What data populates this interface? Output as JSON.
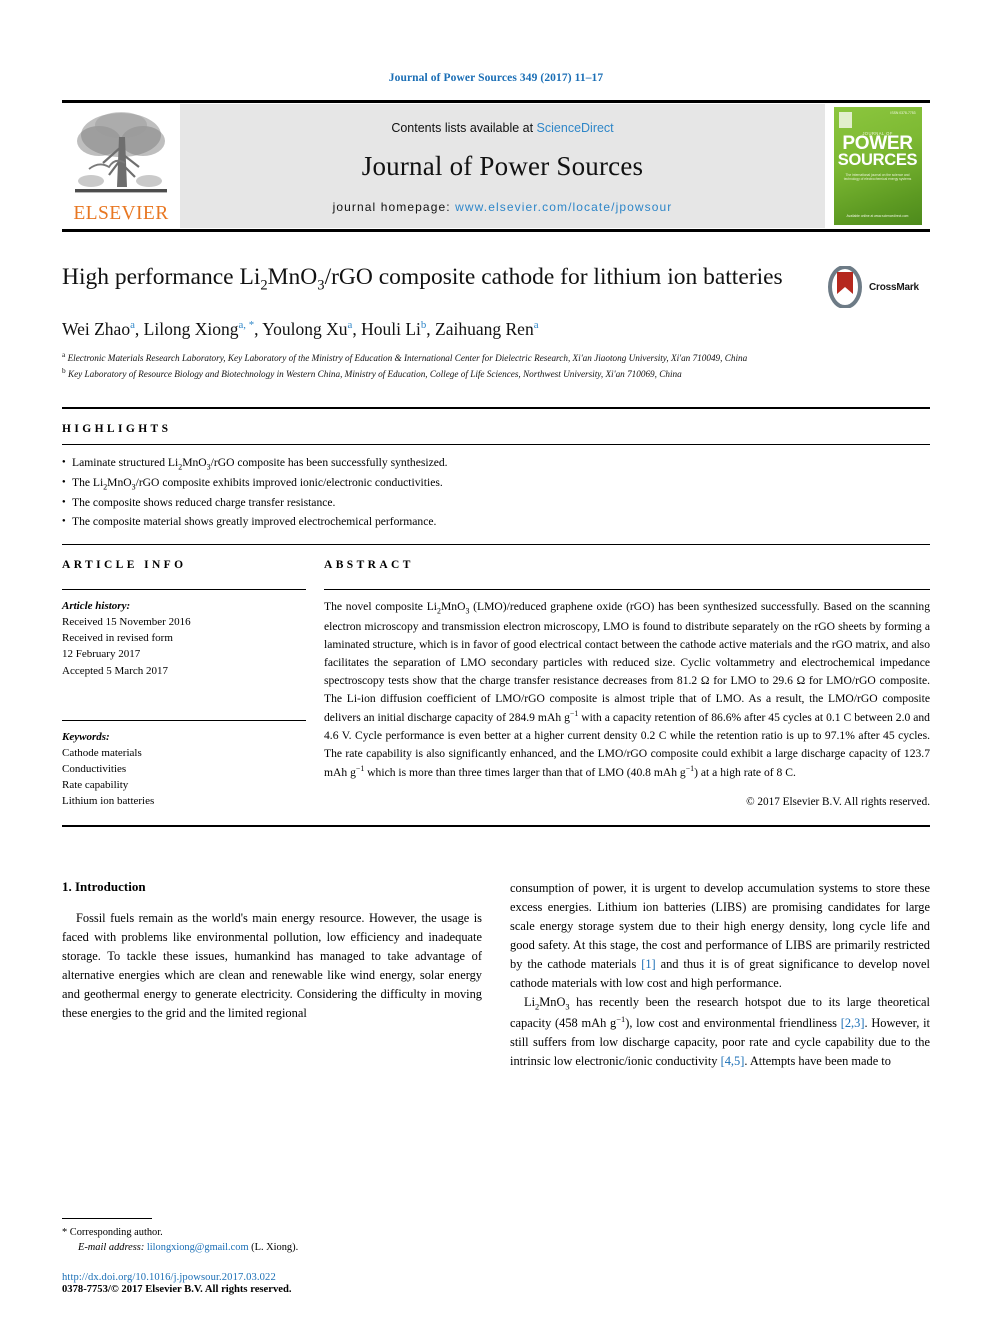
{
  "running_head": "Journal of Power Sources 349 (2017) 11–17",
  "masthead": {
    "publisher_name": "ELSEVIER",
    "publisher_logo": "elsevier-tree-logo",
    "contents_prefix": "Contents lists available at ",
    "contents_link": "ScienceDirect",
    "journal_title": "Journal of Power Sources",
    "homepage_prefix": "journal homepage: ",
    "homepage_url": "www.elsevier.com/locate/jpowsour",
    "cover": {
      "top_label": "ISSN 0378-7753",
      "eyebrow": "JOURNAL OF",
      "line1": "POWER",
      "line2": "SOURCES",
      "subtitle": "The international journal on the science and technology of electrochemical energy systems",
      "footer": "Available online at\nwww.sciencedirect.com",
      "accent": "#7db933"
    }
  },
  "article": {
    "title_part1": "High performance Li",
    "title_sub1": "2",
    "title_part2": "MnO",
    "title_sub2": "3",
    "title_part3": "/rGO composite cathode for lithium ion batteries",
    "title_plain": "High performance Li2MnO3/rGO composite cathode for lithium ion batteries",
    "crossmark_label": "CrossMark",
    "authors": [
      {
        "name": "Wei Zhao",
        "marks": "a"
      },
      {
        "name": "Lilong Xiong",
        "marks": "a, *"
      },
      {
        "name": "Youlong Xu",
        "marks": "a"
      },
      {
        "name": "Houli Li",
        "marks": "b"
      },
      {
        "name": "Zaihuang Ren",
        "marks": "a"
      }
    ],
    "affiliations": [
      {
        "mark": "a",
        "text": "Electronic Materials Research Laboratory, Key Laboratory of the Ministry of Education & International Center for Dielectric Research, Xi'an Jiaotong University, Xi'an 710049, China"
      },
      {
        "mark": "b",
        "text": "Key Laboratory of Resource Biology and Biotechnology in Western China, Ministry of Education, College of Life Sciences, Northwest University, Xi'an 710069, China"
      }
    ]
  },
  "highlights": {
    "label": "HIGHLIGHTS",
    "items": [
      "Laminate structured Li2MnO3/rGO composite has been successfully synthesized.",
      "The Li2MnO3/rGO composite exhibits improved ionic/electronic conductivities.",
      "The composite shows reduced charge transfer resistance.",
      "The composite material shows greatly improved electrochemical performance."
    ]
  },
  "article_info": {
    "label": "ARTICLE INFO",
    "history_label": "Article history:",
    "history": [
      "Received 15 November 2016",
      "Received in revised form",
      "12 February 2017",
      "Accepted 5 March 2017"
    ],
    "keywords_label": "Keywords:",
    "keywords": [
      "Cathode materials",
      "Conductivities",
      "Rate capability",
      "Lithium ion batteries"
    ]
  },
  "abstract": {
    "label": "ABSTRACT",
    "text": "The novel composite Li2MnO3 (LMO)/reduced graphene oxide (rGO) has been synthesized successfully. Based on the scanning electron microscopy and transmission electron microscopy, LMO is found to distribute separately on the rGO sheets by forming a laminated structure, which is in favor of good electrical contact between the cathode active materials and the rGO matrix, and also facilitates the separation of LMO secondary particles with reduced size. Cyclic voltammetry and electrochemical impedance spectroscopy tests show that the charge transfer resistance decreases from 81.2 Ω for LMO to 29.6 Ω for LMO/rGO composite. The Li-ion diffusion coefficient of LMO/rGO composite is almost triple that of LMO. As a result, the LMO/rGO composite delivers an initial discharge capacity of 284.9 mAh g−1 with a capacity retention of 86.6% after 45 cycles at 0.1 C between 2.0 and 4.6 V. Cycle performance is even better at a higher current density 0.2 C while the retention ratio is up to 97.1% after 45 cycles. The rate capability is also significantly enhanced, and the LMO/rGO composite could exhibit a large discharge capacity of 123.7 mAh g−1 which is more than three times larger than that of LMO (40.8 mAh g−1) at a high rate of 8 C.",
    "copyright": "© 2017 Elsevier B.V. All rights reserved."
  },
  "body": {
    "section_number_title": "1. Introduction",
    "left_paragraph": "Fossil fuels remain as the world's main energy resource. However, the usage is faced with problems like environmental pollution, low efficiency and inadequate storage. To tackle these issues, humankind has managed to take advantage of alternative energies which are clean and renewable like wind energy, solar energy and geothermal energy to generate electricity. Considering the difficulty in moving these energies to the grid and the limited regional",
    "right_paragraph_1": "consumption of power, it is urgent to develop accumulation systems to store these excess energies. Lithium ion batteries (LIBS) are promising candidates for large scale energy storage system due to their high energy density, long cycle life and good safety. At this stage, the cost and performance of LIBS are primarily restricted by the cathode materials [1] and thus it is of great significance to develop novel cathode materials with low cost and high performance.",
    "right_paragraph_2": "Li2MnO3 has recently been the research hotspot due to its large theoretical capacity (458 mAh g−1), low cost and environmental friendliness [2,3]. However, it still suffers from low discharge capacity, poor rate and cycle capability due to the intrinsic low electronic/ionic conductivity [4,5]. Attempts have been made to",
    "ref_1": "[1]",
    "ref_23": "[2,3]",
    "ref_45": "[4,5]"
  },
  "footnotes": {
    "corresponding": "* Corresponding author.",
    "email_label": "E-mail address:",
    "email": "lilongxiong@gmail.com",
    "email_owner": "(L. Xiong).",
    "doi": "http://dx.doi.org/10.1016/j.jpowsour.2017.03.022",
    "issn": "0378-7753/© 2017 Elsevier B.V. All rights reserved."
  },
  "colors": {
    "link_blue": "#1a6eb5",
    "sciencedirect_blue": "#2e86c8",
    "elsevier_orange": "#E87722",
    "cover_green": "#7db933",
    "crossmark_red": "#b5281e"
  }
}
